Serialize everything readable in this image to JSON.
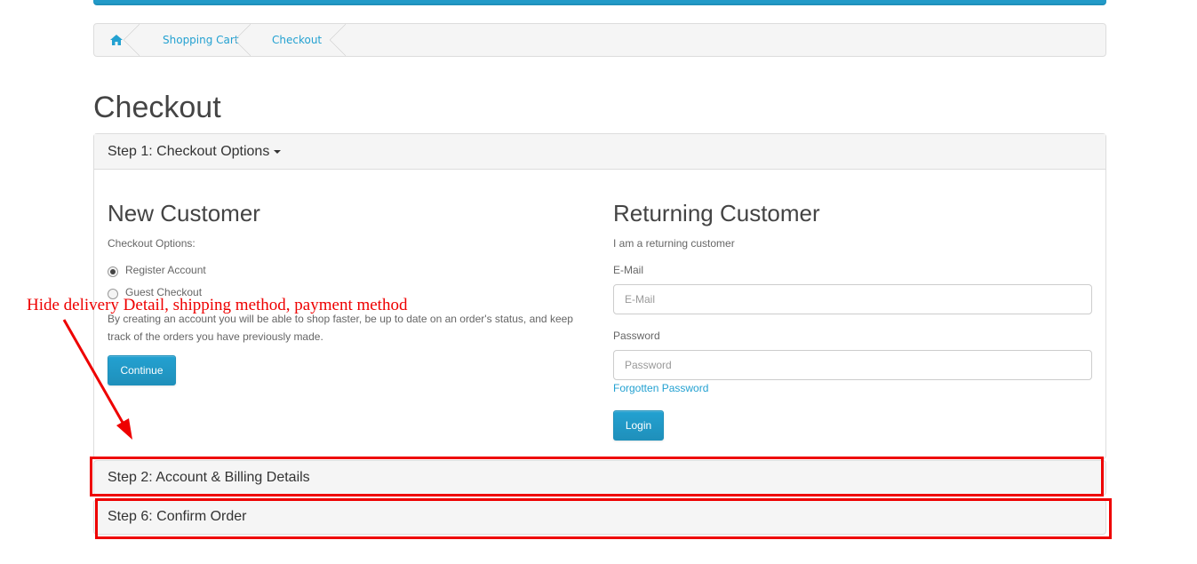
{
  "breadcrumb": {
    "home_icon": "home-icon",
    "items": [
      "Shopping Cart",
      "Checkout"
    ]
  },
  "page": {
    "title": "Checkout"
  },
  "step1": {
    "heading": "Step 1: Checkout Options",
    "new_customer": {
      "title": "New Customer",
      "options_label": "Checkout Options:",
      "register_label": "Register Account",
      "guest_label": "Guest Checkout",
      "selected": "Register Account",
      "description": "By creating an account you will be able to shop faster, be up to date on an order's status, and keep track of the orders you have previously made.",
      "continue_button": "Continue"
    },
    "returning_customer": {
      "title": "Returning Customer",
      "subtitle": "I am a returning customer",
      "email_label": "E-Mail",
      "email_placeholder": "E-Mail",
      "password_label": "Password",
      "password_placeholder": "Password",
      "forgot_link": "Forgotten Password",
      "login_button": "Login"
    }
  },
  "step2": {
    "heading": "Step 2: Account & Billing Details"
  },
  "step6": {
    "heading": "Step 6: Confirm Order"
  },
  "annotation": {
    "text": "Hide delivery Detail, shipping method, payment method",
    "color": "#ee0000"
  },
  "colors": {
    "accent": "#229ac8",
    "link": "#23a1d1",
    "annotation_red": "#ee0000"
  }
}
